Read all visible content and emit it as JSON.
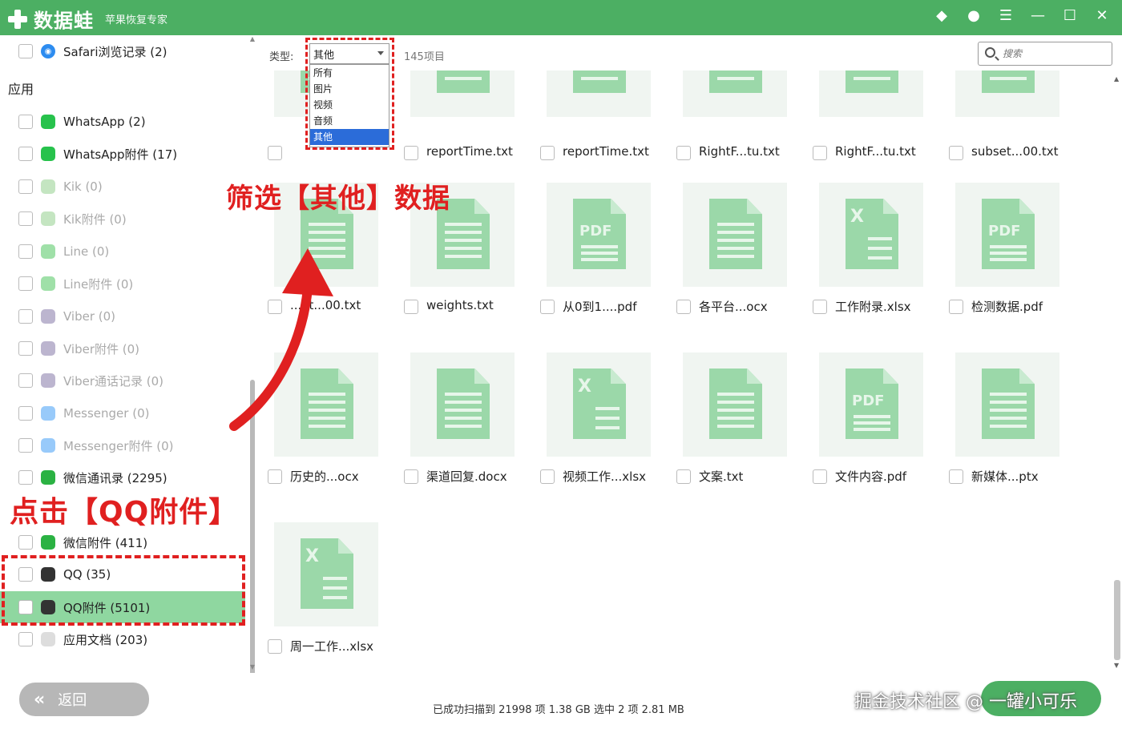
{
  "app": {
    "name": "数据蛙",
    "subtitle": "苹果恢复专家",
    "title_icons": [
      "diamond-icon",
      "chat-icon",
      "menu-icon",
      "minimize-icon",
      "maximize-icon",
      "close-icon"
    ]
  },
  "sidebar": {
    "top_item": {
      "label": "Safari浏览记录 (2)",
      "icon": "safari-icon"
    },
    "section_title": "应用",
    "items": [
      {
        "label": "WhatsApp (2)",
        "icon": "whatsapp-icon",
        "color": "#27c24c",
        "dim": false
      },
      {
        "label": "WhatsApp附件 (17)",
        "icon": "whatsapp-icon",
        "color": "#27c24c",
        "dim": false
      },
      {
        "label": "Kik (0)",
        "icon": "kik-icon",
        "color": "#7cc576",
        "dim": true
      },
      {
        "label": "Kik附件 (0)",
        "icon": "kik-icon",
        "color": "#7cc576",
        "dim": true
      },
      {
        "label": "Line (0)",
        "icon": "line-icon",
        "color": "#2bbb3e",
        "dim": true
      },
      {
        "label": "Line附件 (0)",
        "icon": "line-icon",
        "color": "#2bbb3e",
        "dim": true
      },
      {
        "label": "Viber (0)",
        "icon": "viber-icon",
        "color": "#6b5b95",
        "dim": true
      },
      {
        "label": "Viber附件 (0)",
        "icon": "viber-icon",
        "color": "#6b5b95",
        "dim": true
      },
      {
        "label": "Viber通话记录 (0)",
        "icon": "viber-icon",
        "color": "#6b5b95",
        "dim": true
      },
      {
        "label": "Messenger (0)",
        "icon": "messenger-icon",
        "color": "#1b8af3",
        "dim": true
      },
      {
        "label": "Messenger附件 (0)",
        "icon": "messenger-icon",
        "color": "#1b8af3",
        "dim": true
      },
      {
        "label": "微信通讯录 (2295)",
        "icon": "wechat-icon",
        "color": "#2bb243",
        "dim": false
      },
      {
        "label": "微信附件 (411)",
        "icon": "wechat-icon",
        "color": "#2bb243",
        "dim": false
      },
      {
        "label": "QQ (35)",
        "icon": "qq-icon",
        "color": "#333333",
        "dim": false
      },
      {
        "label": "QQ附件 (5101)",
        "icon": "qq-icon",
        "color": "#333333",
        "dim": false,
        "selected": true
      },
      {
        "label": "应用文档 (203)",
        "icon": "app-doc-icon",
        "color": "#dddddd",
        "dim": false
      }
    ]
  },
  "toolbar": {
    "type_label": "类型:",
    "type_value": "其他",
    "type_options": [
      "所有",
      "图片",
      "视频",
      "音频",
      "其他"
    ],
    "count_text": "145项目",
    "search_placeholder": "搜索"
  },
  "files": [
    {
      "name": "",
      "kind": "txt"
    },
    {
      "name": "reportTime.txt",
      "kind": "txt"
    },
    {
      "name": "reportTime.txt",
      "kind": "txt"
    },
    {
      "name": "RightF...tu.txt",
      "kind": "txt"
    },
    {
      "name": "RightF...tu.txt",
      "kind": "txt"
    },
    {
      "name": "subset...00.txt",
      "kind": "txt"
    },
    {
      "name": "...et...00.txt",
      "kind": "txt"
    },
    {
      "name": "weights.txt",
      "kind": "txt"
    },
    {
      "name": "从0到1....pdf",
      "kind": "pdf"
    },
    {
      "name": "各平台...ocx",
      "kind": "doc"
    },
    {
      "name": "工作附录.xlsx",
      "kind": "xls"
    },
    {
      "name": "检测数据.pdf",
      "kind": "pdf"
    },
    {
      "name": "历史的...ocx",
      "kind": "doc"
    },
    {
      "name": "渠道回复.docx",
      "kind": "doc"
    },
    {
      "name": "视频工作...xlsx",
      "kind": "xls"
    },
    {
      "name": "文案.txt",
      "kind": "txt"
    },
    {
      "name": "文件内容.pdf",
      "kind": "pdf"
    },
    {
      "name": "新媒体...ptx",
      "kind": "txt"
    },
    {
      "name": "周一工作...xlsx",
      "kind": "xls"
    }
  ],
  "bottom": {
    "back_label": "返回",
    "status": "已成功扫描到 21998 项 1.38 GB  选中 2 项 2.81 MB",
    "watermark": "掘金技术社区 @ 一罐小可乐"
  },
  "annotations": {
    "filter_note": "筛选【其他】数据",
    "click_note": "点击【QQ附件】"
  }
}
